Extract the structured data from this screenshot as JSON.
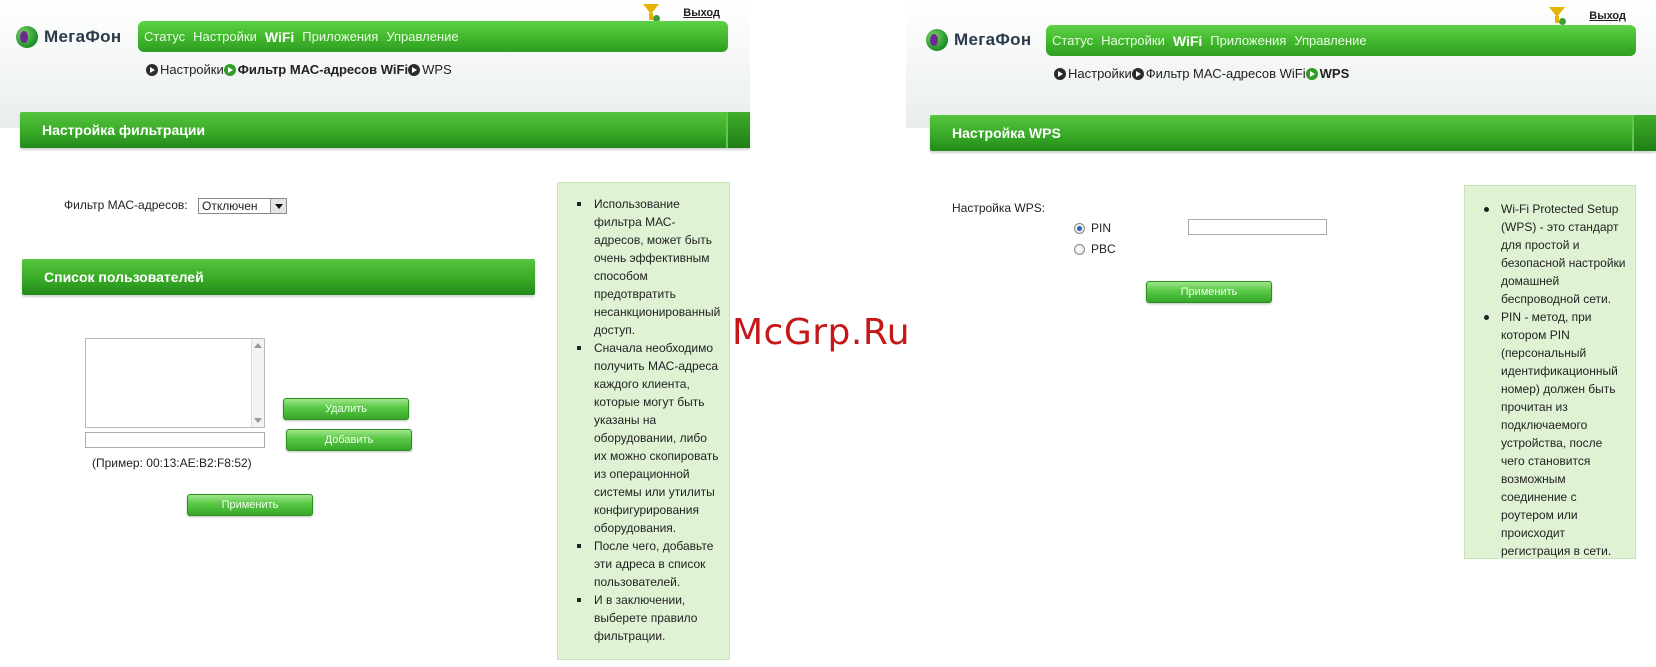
{
  "left": {
    "logo": "МегаФон",
    "exit": "Выход",
    "nav": [
      {
        "label": "Статус",
        "active": false
      },
      {
        "label": "Настройки",
        "active": false
      },
      {
        "label": "WiFi",
        "active": true
      },
      {
        "label": "Приложения",
        "active": false
      },
      {
        "label": "Управление",
        "active": false
      }
    ],
    "subnav": [
      {
        "label": "Настройки",
        "active": false
      },
      {
        "label": "Фильтр МАС-адресов WiFi",
        "active": true
      },
      {
        "label": "WPS",
        "active": false
      }
    ],
    "filter_section_title": "Настройка фильтрации",
    "filter_label": "Фильтр МАС-адресов:",
    "filter_value": "Отключен",
    "users_section_title": "Список пользователей",
    "delete_label": "Удалить",
    "add_label": "Добавить",
    "example": "(Пример: 00:13:AE:B2:F8:52)",
    "apply_label": "Применить",
    "help": [
      "Использование фильтра МАС-адресов, может быть очень эффективным способом предотвратить несанкционированный доступ.",
      "Сначала необходимо получить МАС-адреса каждого клиента, которые могут быть указаны на оборудовании, либо их можно скопировать из операционной системы или утилиты конфигурирования оборудования.",
      "После чего, добавьте эти адреса в список пользователей.",
      "И в заключении, выберете правило фильтрации."
    ]
  },
  "right": {
    "logo": "МегаФон",
    "exit": "Выход",
    "nav": [
      {
        "label": "Статус",
        "active": false
      },
      {
        "label": "Настройки",
        "active": false
      },
      {
        "label": "WiFi",
        "active": true
      },
      {
        "label": "Приложения",
        "active": false
      },
      {
        "label": "Управление",
        "active": false
      }
    ],
    "subnav": [
      {
        "label": "Настройки",
        "active": false
      },
      {
        "label": "Фильтр МАС-адресов WiFi",
        "active": false
      },
      {
        "label": "WPS",
        "active": true
      }
    ],
    "section_title": "Настройка WPS",
    "wps_label": "Настройка WPS:",
    "pin_label": "PIN",
    "pbc_label": "PBC",
    "selected_mode": "PIN",
    "apply_label": "Применить",
    "help": [
      "Wi-Fi Protected Setup (WPS) - это стандарт для простой и безопасной настройки домашней беспроводной сети.",
      "PIN - метод, при котором PIN (персональный идентификационный номер) должен быть прочитан из подключаемого устройства, после чего становится возможным соединение с роутером или происходит регистрация в сети."
    ]
  },
  "watermark": "McGrp.Ru",
  "colors": {
    "accent_green": "#43b92e",
    "help_bg": "#dff2d4",
    "watermark": "#c41818"
  }
}
